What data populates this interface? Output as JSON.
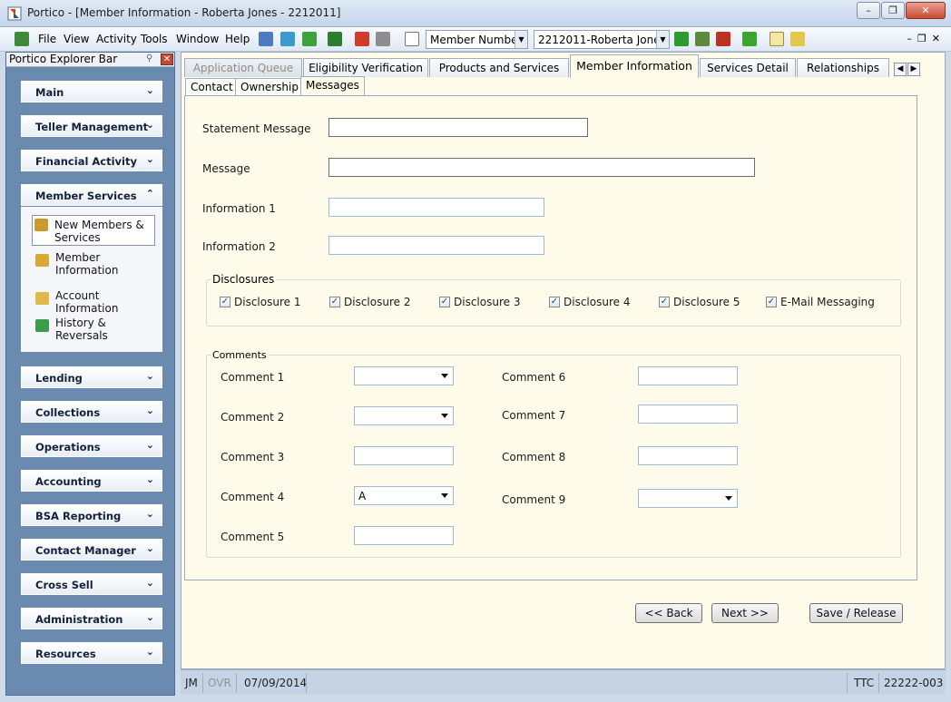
{
  "window": {
    "title": "Portico - [Member Information - Roberta Jones - 2212011]"
  },
  "menu": [
    "File",
    "View",
    "Activity",
    "Tools",
    "Window",
    "Help"
  ],
  "toolbar": {
    "search_type": "Member Numbe",
    "member_select": "2212011-Roberta Jone"
  },
  "explorer": {
    "title": "Portico Explorer Bar",
    "groups_top": [
      "Main",
      "Teller Management",
      "Financial Activity"
    ],
    "open_group": "Member Services",
    "open_items": [
      "New Members & Services",
      "Member Information",
      "Account Information",
      "History & Reversals"
    ],
    "groups_bottom": [
      "Lending",
      "Collections",
      "Operations",
      "Accounting",
      "BSA Reporting",
      "Contact Manager",
      "Cross Sell",
      "Administration",
      "Resources"
    ]
  },
  "tabs": [
    "Application Queue",
    "Eligibility Verification",
    "Products and Services",
    "Member Information",
    "Services Detail",
    "Relationships"
  ],
  "subtabs": [
    "Contact",
    "Ownership",
    "Messages"
  ],
  "form": {
    "statement_message_label": "Statement Message",
    "message_label": "Message",
    "info1_label": "Information 1",
    "info2_label": "Information 2",
    "disclosures_title": "Disclosures",
    "disclosures": [
      "Disclosure 1",
      "Disclosure 2",
      "Disclosure 3",
      "Disclosure 4",
      "Disclosure 5",
      "E-Mail Messaging"
    ],
    "comments_title": "Comments",
    "comments": {
      "c1": "Comment 1",
      "c2": "Comment 2",
      "c3": "Comment 3",
      "c4": "Comment 4",
      "c5": "Comment 5",
      "c6": "Comment 6",
      "c7": "Comment 7",
      "c8": "Comment 8",
      "c9": "Comment 9",
      "c4_value": "A"
    }
  },
  "buttons": {
    "back": "<< Back",
    "next": "Next >>",
    "save": "Save / Release"
  },
  "status": {
    "user": "JM",
    "ovr": "OVR",
    "date": "07/09/2014",
    "ttc": "TTC",
    "code": "22222-003"
  },
  "colors": {
    "explorer_bg": "#6b8ab0",
    "main_bg": "#fefbea"
  }
}
